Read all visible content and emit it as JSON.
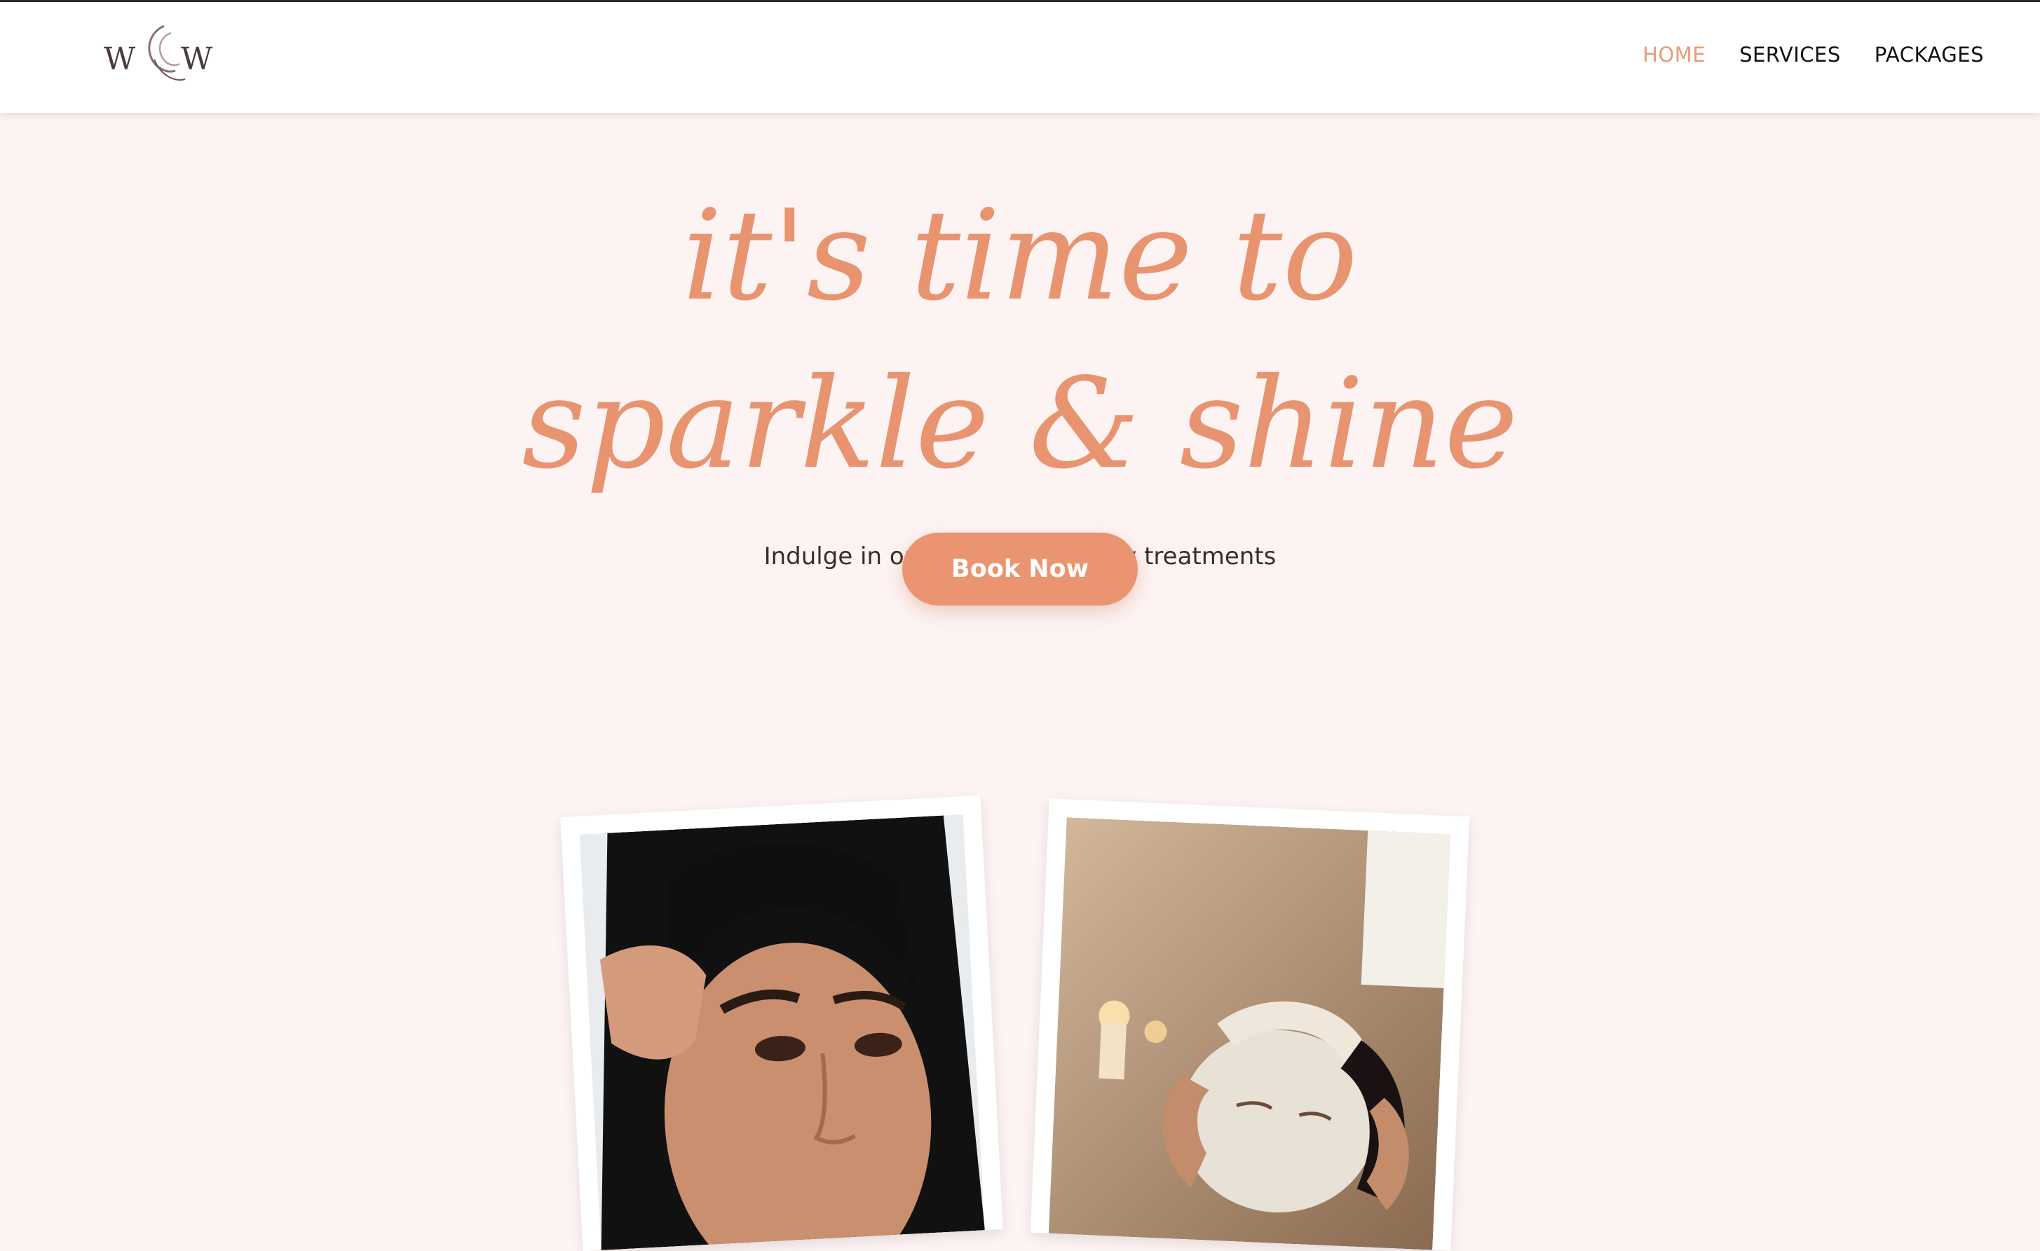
{
  "brand": {
    "logo_icon": "wow-logo-icon",
    "logo_text": "WOW"
  },
  "nav": {
    "items": [
      {
        "label": "HOME",
        "active": true
      },
      {
        "label": "SERVICES",
        "active": false
      },
      {
        "label": "PACKAGES",
        "active": false
      }
    ]
  },
  "hero": {
    "headline_line1": "it's time to",
    "headline_line2": "sparkle & shine",
    "subtitle": "Indulge in our luxurious beauty treatments",
    "cta_label": "Book Now"
  },
  "gallery": [
    {
      "icon": "eyebrow-threading-photo"
    },
    {
      "icon": "facial-mask-photo"
    }
  ],
  "colors": {
    "accent": "#e89470",
    "background": "#fdf3f3",
    "button": "#ea9471",
    "nav_text": "#111111"
  }
}
